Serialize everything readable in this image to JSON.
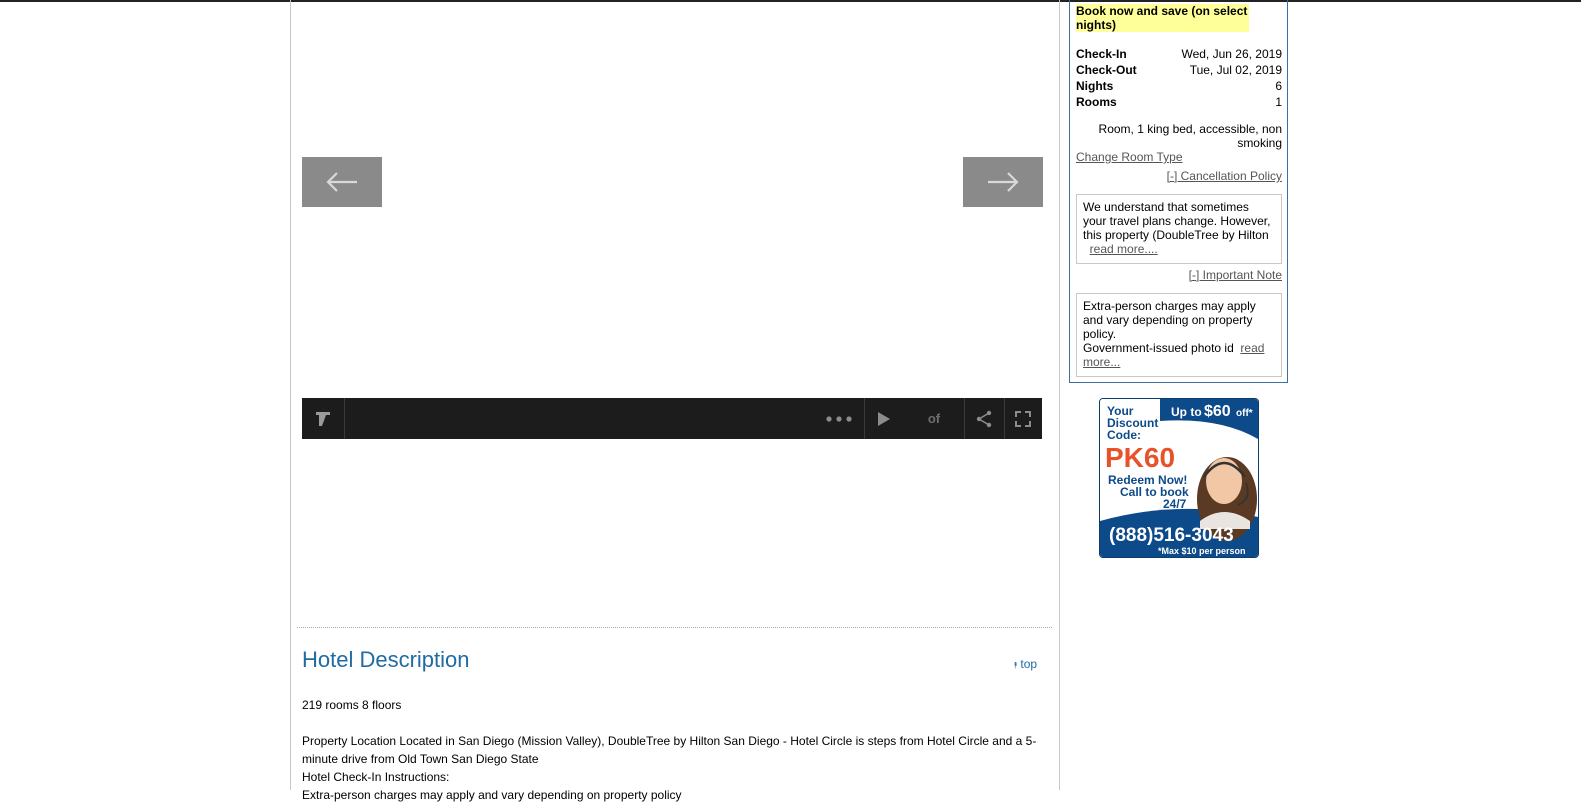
{
  "gallery": {
    "prev_icon": "arrow-left-icon",
    "next_icon": "arrow-right-icon"
  },
  "player": {
    "logo_icon": "player-logo-icon",
    "more_icon": "more-dots-icon",
    "play_icon": "play-icon",
    "counter_text": "of",
    "share_icon": "share-icon",
    "fullscreen_icon": "fullscreen-icon"
  },
  "hotel_description": {
    "title": "Hotel Description",
    "top_link": "top",
    "top_icon": "double-chevron-up-icon",
    "rooms_floors": "219 rooms 8 floors",
    "location": "Property Location Located in San Diego (Mission Valley), DoubleTree by Hilton San Diego - Hotel Circle is steps from Hotel Circle and a 5-minute drive from Old Town San Diego State",
    "checkin_heading": "Hotel Check-In Instructions:",
    "cut_off_line": "Extra-person charges may apply and vary depending on property policy"
  },
  "booking": {
    "promo": "Book now and save (on select nights)",
    "checkin_label": "Check-In",
    "checkin_value": "Wed, Jun 26, 2019",
    "checkout_label": "Check-Out",
    "checkout_value": "Tue, Jul 02, 2019",
    "nights_label": "Nights",
    "nights_value": "6",
    "rooms_label": "Rooms",
    "rooms_value": "1",
    "room_type": "Room, 1 king bed, accessible, non smoking",
    "change_room": "Change Room Type",
    "cancellation_toggle": "[-] Cancellation Policy",
    "cancellation_text": "We understand that sometimes your travel plans change. However, this property (DoubleTree by Hilton",
    "read_more_1": "read more....",
    "important_toggle": "[-] Important Note",
    "important_text_1": "Extra-person charges may apply and vary depending on property policy.",
    "important_text_2": "Government-issued photo id",
    "read_more_2": "read more..."
  },
  "ad": {
    "your": "Your",
    "discount": "Discount",
    "code": "Code:",
    "up_to": "Up to",
    "amount": "$60",
    "off": "off*",
    "promo_code": "PK60",
    "redeem": "Redeem Now!",
    "call": "Call to book",
    "hours": "24/7",
    "phone": "(888)516-3043",
    "footnote": "*Max $10 per person",
    "agent_image": "headset-agent-photo"
  },
  "colors": {
    "accent_blue": "#1f6ca3",
    "promo_yellow": "#ffff99",
    "ad_orange": "#e8522a",
    "ad_navy": "#0d4a8a"
  }
}
